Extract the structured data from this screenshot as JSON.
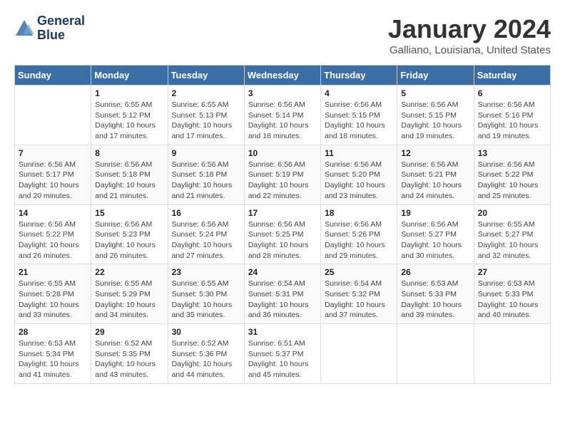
{
  "logo": {
    "line1": "General",
    "line2": "Blue"
  },
  "title": "January 2024",
  "subtitle": "Galliano, Louisiana, United States",
  "headers": [
    "Sunday",
    "Monday",
    "Tuesday",
    "Wednesday",
    "Thursday",
    "Friday",
    "Saturday"
  ],
  "weeks": [
    [
      {
        "day": "",
        "sunrise": "",
        "sunset": "",
        "daylight": ""
      },
      {
        "day": "1",
        "sunrise": "Sunrise: 6:55 AM",
        "sunset": "Sunset: 5:12 PM",
        "daylight": "Daylight: 10 hours and 17 minutes."
      },
      {
        "day": "2",
        "sunrise": "Sunrise: 6:55 AM",
        "sunset": "Sunset: 5:13 PM",
        "daylight": "Daylight: 10 hours and 17 minutes."
      },
      {
        "day": "3",
        "sunrise": "Sunrise: 6:56 AM",
        "sunset": "Sunset: 5:14 PM",
        "daylight": "Daylight: 10 hours and 18 minutes."
      },
      {
        "day": "4",
        "sunrise": "Sunrise: 6:56 AM",
        "sunset": "Sunset: 5:15 PM",
        "daylight": "Daylight: 10 hours and 18 minutes."
      },
      {
        "day": "5",
        "sunrise": "Sunrise: 6:56 AM",
        "sunset": "Sunset: 5:15 PM",
        "daylight": "Daylight: 10 hours and 19 minutes."
      },
      {
        "day": "6",
        "sunrise": "Sunrise: 6:56 AM",
        "sunset": "Sunset: 5:16 PM",
        "daylight": "Daylight: 10 hours and 19 minutes."
      }
    ],
    [
      {
        "day": "7",
        "sunrise": "Sunrise: 6:56 AM",
        "sunset": "Sunset: 5:17 PM",
        "daylight": "Daylight: 10 hours and 20 minutes."
      },
      {
        "day": "8",
        "sunrise": "Sunrise: 6:56 AM",
        "sunset": "Sunset: 5:18 PM",
        "daylight": "Daylight: 10 hours and 21 minutes."
      },
      {
        "day": "9",
        "sunrise": "Sunrise: 6:56 AM",
        "sunset": "Sunset: 5:18 PM",
        "daylight": "Daylight: 10 hours and 21 minutes."
      },
      {
        "day": "10",
        "sunrise": "Sunrise: 6:56 AM",
        "sunset": "Sunset: 5:19 PM",
        "daylight": "Daylight: 10 hours and 22 minutes."
      },
      {
        "day": "11",
        "sunrise": "Sunrise: 6:56 AM",
        "sunset": "Sunset: 5:20 PM",
        "daylight": "Daylight: 10 hours and 23 minutes."
      },
      {
        "day": "12",
        "sunrise": "Sunrise: 6:56 AM",
        "sunset": "Sunset: 5:21 PM",
        "daylight": "Daylight: 10 hours and 24 minutes."
      },
      {
        "day": "13",
        "sunrise": "Sunrise: 6:56 AM",
        "sunset": "Sunset: 5:22 PM",
        "daylight": "Daylight: 10 hours and 25 minutes."
      }
    ],
    [
      {
        "day": "14",
        "sunrise": "Sunrise: 6:56 AM",
        "sunset": "Sunset: 5:22 PM",
        "daylight": "Daylight: 10 hours and 26 minutes."
      },
      {
        "day": "15",
        "sunrise": "Sunrise: 6:56 AM",
        "sunset": "Sunset: 5:23 PM",
        "daylight": "Daylight: 10 hours and 26 minutes."
      },
      {
        "day": "16",
        "sunrise": "Sunrise: 6:56 AM",
        "sunset": "Sunset: 5:24 PM",
        "daylight": "Daylight: 10 hours and 27 minutes."
      },
      {
        "day": "17",
        "sunrise": "Sunrise: 6:56 AM",
        "sunset": "Sunset: 5:25 PM",
        "daylight": "Daylight: 10 hours and 28 minutes."
      },
      {
        "day": "18",
        "sunrise": "Sunrise: 6:56 AM",
        "sunset": "Sunset: 5:26 PM",
        "daylight": "Daylight: 10 hours and 29 minutes."
      },
      {
        "day": "19",
        "sunrise": "Sunrise: 6:56 AM",
        "sunset": "Sunset: 5:27 PM",
        "daylight": "Daylight: 10 hours and 30 minutes."
      },
      {
        "day": "20",
        "sunrise": "Sunrise: 6:55 AM",
        "sunset": "Sunset: 5:27 PM",
        "daylight": "Daylight: 10 hours and 32 minutes."
      }
    ],
    [
      {
        "day": "21",
        "sunrise": "Sunrise: 6:55 AM",
        "sunset": "Sunset: 5:28 PM",
        "daylight": "Daylight: 10 hours and 33 minutes."
      },
      {
        "day": "22",
        "sunrise": "Sunrise: 6:55 AM",
        "sunset": "Sunset: 5:29 PM",
        "daylight": "Daylight: 10 hours and 34 minutes."
      },
      {
        "day": "23",
        "sunrise": "Sunrise: 6:55 AM",
        "sunset": "Sunset: 5:30 PM",
        "daylight": "Daylight: 10 hours and 35 minutes."
      },
      {
        "day": "24",
        "sunrise": "Sunrise: 6:54 AM",
        "sunset": "Sunset: 5:31 PM",
        "daylight": "Daylight: 10 hours and 36 minutes."
      },
      {
        "day": "25",
        "sunrise": "Sunrise: 6:54 AM",
        "sunset": "Sunset: 5:32 PM",
        "daylight": "Daylight: 10 hours and 37 minutes."
      },
      {
        "day": "26",
        "sunrise": "Sunrise: 6:53 AM",
        "sunset": "Sunset: 5:33 PM",
        "daylight": "Daylight: 10 hours and 39 minutes."
      },
      {
        "day": "27",
        "sunrise": "Sunrise: 6:53 AM",
        "sunset": "Sunset: 5:33 PM",
        "daylight": "Daylight: 10 hours and 40 minutes."
      }
    ],
    [
      {
        "day": "28",
        "sunrise": "Sunrise: 6:53 AM",
        "sunset": "Sunset: 5:34 PM",
        "daylight": "Daylight: 10 hours and 41 minutes."
      },
      {
        "day": "29",
        "sunrise": "Sunrise: 6:52 AM",
        "sunset": "Sunset: 5:35 PM",
        "daylight": "Daylight: 10 hours and 43 minutes."
      },
      {
        "day": "30",
        "sunrise": "Sunrise: 6:52 AM",
        "sunset": "Sunset: 5:36 PM",
        "daylight": "Daylight: 10 hours and 44 minutes."
      },
      {
        "day": "31",
        "sunrise": "Sunrise: 6:51 AM",
        "sunset": "Sunset: 5:37 PM",
        "daylight": "Daylight: 10 hours and 45 minutes."
      },
      {
        "day": "",
        "sunrise": "",
        "sunset": "",
        "daylight": ""
      },
      {
        "day": "",
        "sunrise": "",
        "sunset": "",
        "daylight": ""
      },
      {
        "day": "",
        "sunrise": "",
        "sunset": "",
        "daylight": ""
      }
    ]
  ]
}
